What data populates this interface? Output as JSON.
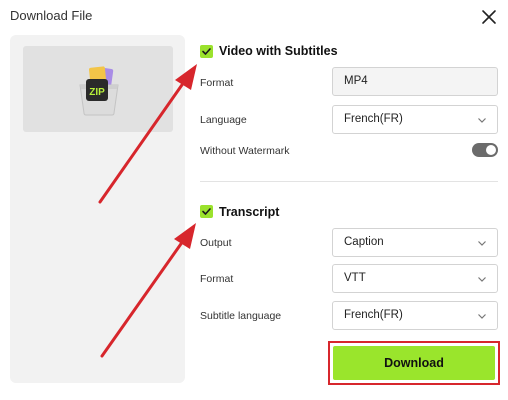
{
  "dialog": {
    "title": "Download File",
    "close_icon": "close-icon"
  },
  "preview": {
    "file_icon": "zip-file-icon",
    "file_icon_text": "ZIP"
  },
  "video_section": {
    "checked": true,
    "title": "Video with Subtitles",
    "format_label": "Format",
    "format_value": "MP4",
    "language_label": "Language",
    "language_value": "French(FR)",
    "watermark_label": "Without Watermark",
    "watermark_enabled": true
  },
  "transcript_section": {
    "checked": true,
    "title": "Transcript",
    "output_label": "Output",
    "output_value": "Caption",
    "format_label": "Format",
    "format_value": "VTT",
    "subtitle_language_label": "Subtitle language",
    "subtitle_language_value": "French(FR)"
  },
  "actions": {
    "download_label": "Download"
  },
  "colors": {
    "accent_green": "#9ae52c",
    "highlight_red": "#d7262c",
    "toggle_dark": "#6b6b6b"
  }
}
